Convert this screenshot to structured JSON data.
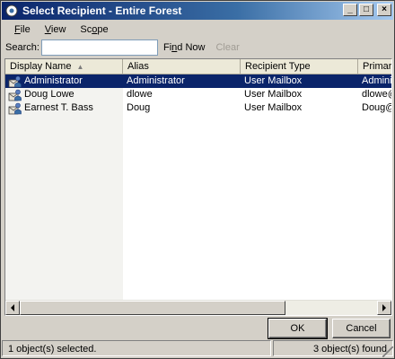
{
  "window": {
    "title": "Select Recipient - Entire Forest",
    "controls": {
      "minimize": "_",
      "maximize": "□",
      "close": "×"
    }
  },
  "menu": {
    "items": [
      {
        "label_pre": "",
        "label_u": "F",
        "label_post": "ile"
      },
      {
        "label_pre": "",
        "label_u": "V",
        "label_post": "iew"
      },
      {
        "label_pre": "Sc",
        "label_u": "o",
        "label_post": "pe"
      }
    ]
  },
  "search": {
    "label": "Search:",
    "value": "",
    "find_now_pre": "Fi",
    "find_now_u": "n",
    "find_now_post": "d Now",
    "clear_label": "Clear"
  },
  "list": {
    "columns": [
      "Display Name",
      "Alias",
      "Recipient Type",
      "Primary"
    ],
    "sort_indicator": "▲",
    "rows": [
      {
        "name": "Administrator",
        "alias": "Administrator",
        "type": "User Mailbox",
        "primary": "Administ",
        "selected": true
      },
      {
        "name": "Doug Lowe",
        "alias": "dlowe",
        "type": "User Mailbox",
        "primary": "dlowe@",
        "selected": false
      },
      {
        "name": "Earnest T. Bass",
        "alias": "Doug",
        "type": "User Mailbox",
        "primary": "Doug@",
        "selected": false
      }
    ],
    "row_icon": "user-mailbox-icon"
  },
  "buttons": {
    "ok": "OK",
    "cancel": "Cancel"
  },
  "status": {
    "left": "1 object(s) selected.",
    "right": "3 object(s) found."
  },
  "colors": {
    "title_start": "#0a246a",
    "selection": "#0a246a",
    "face": "#d4d0c8"
  }
}
